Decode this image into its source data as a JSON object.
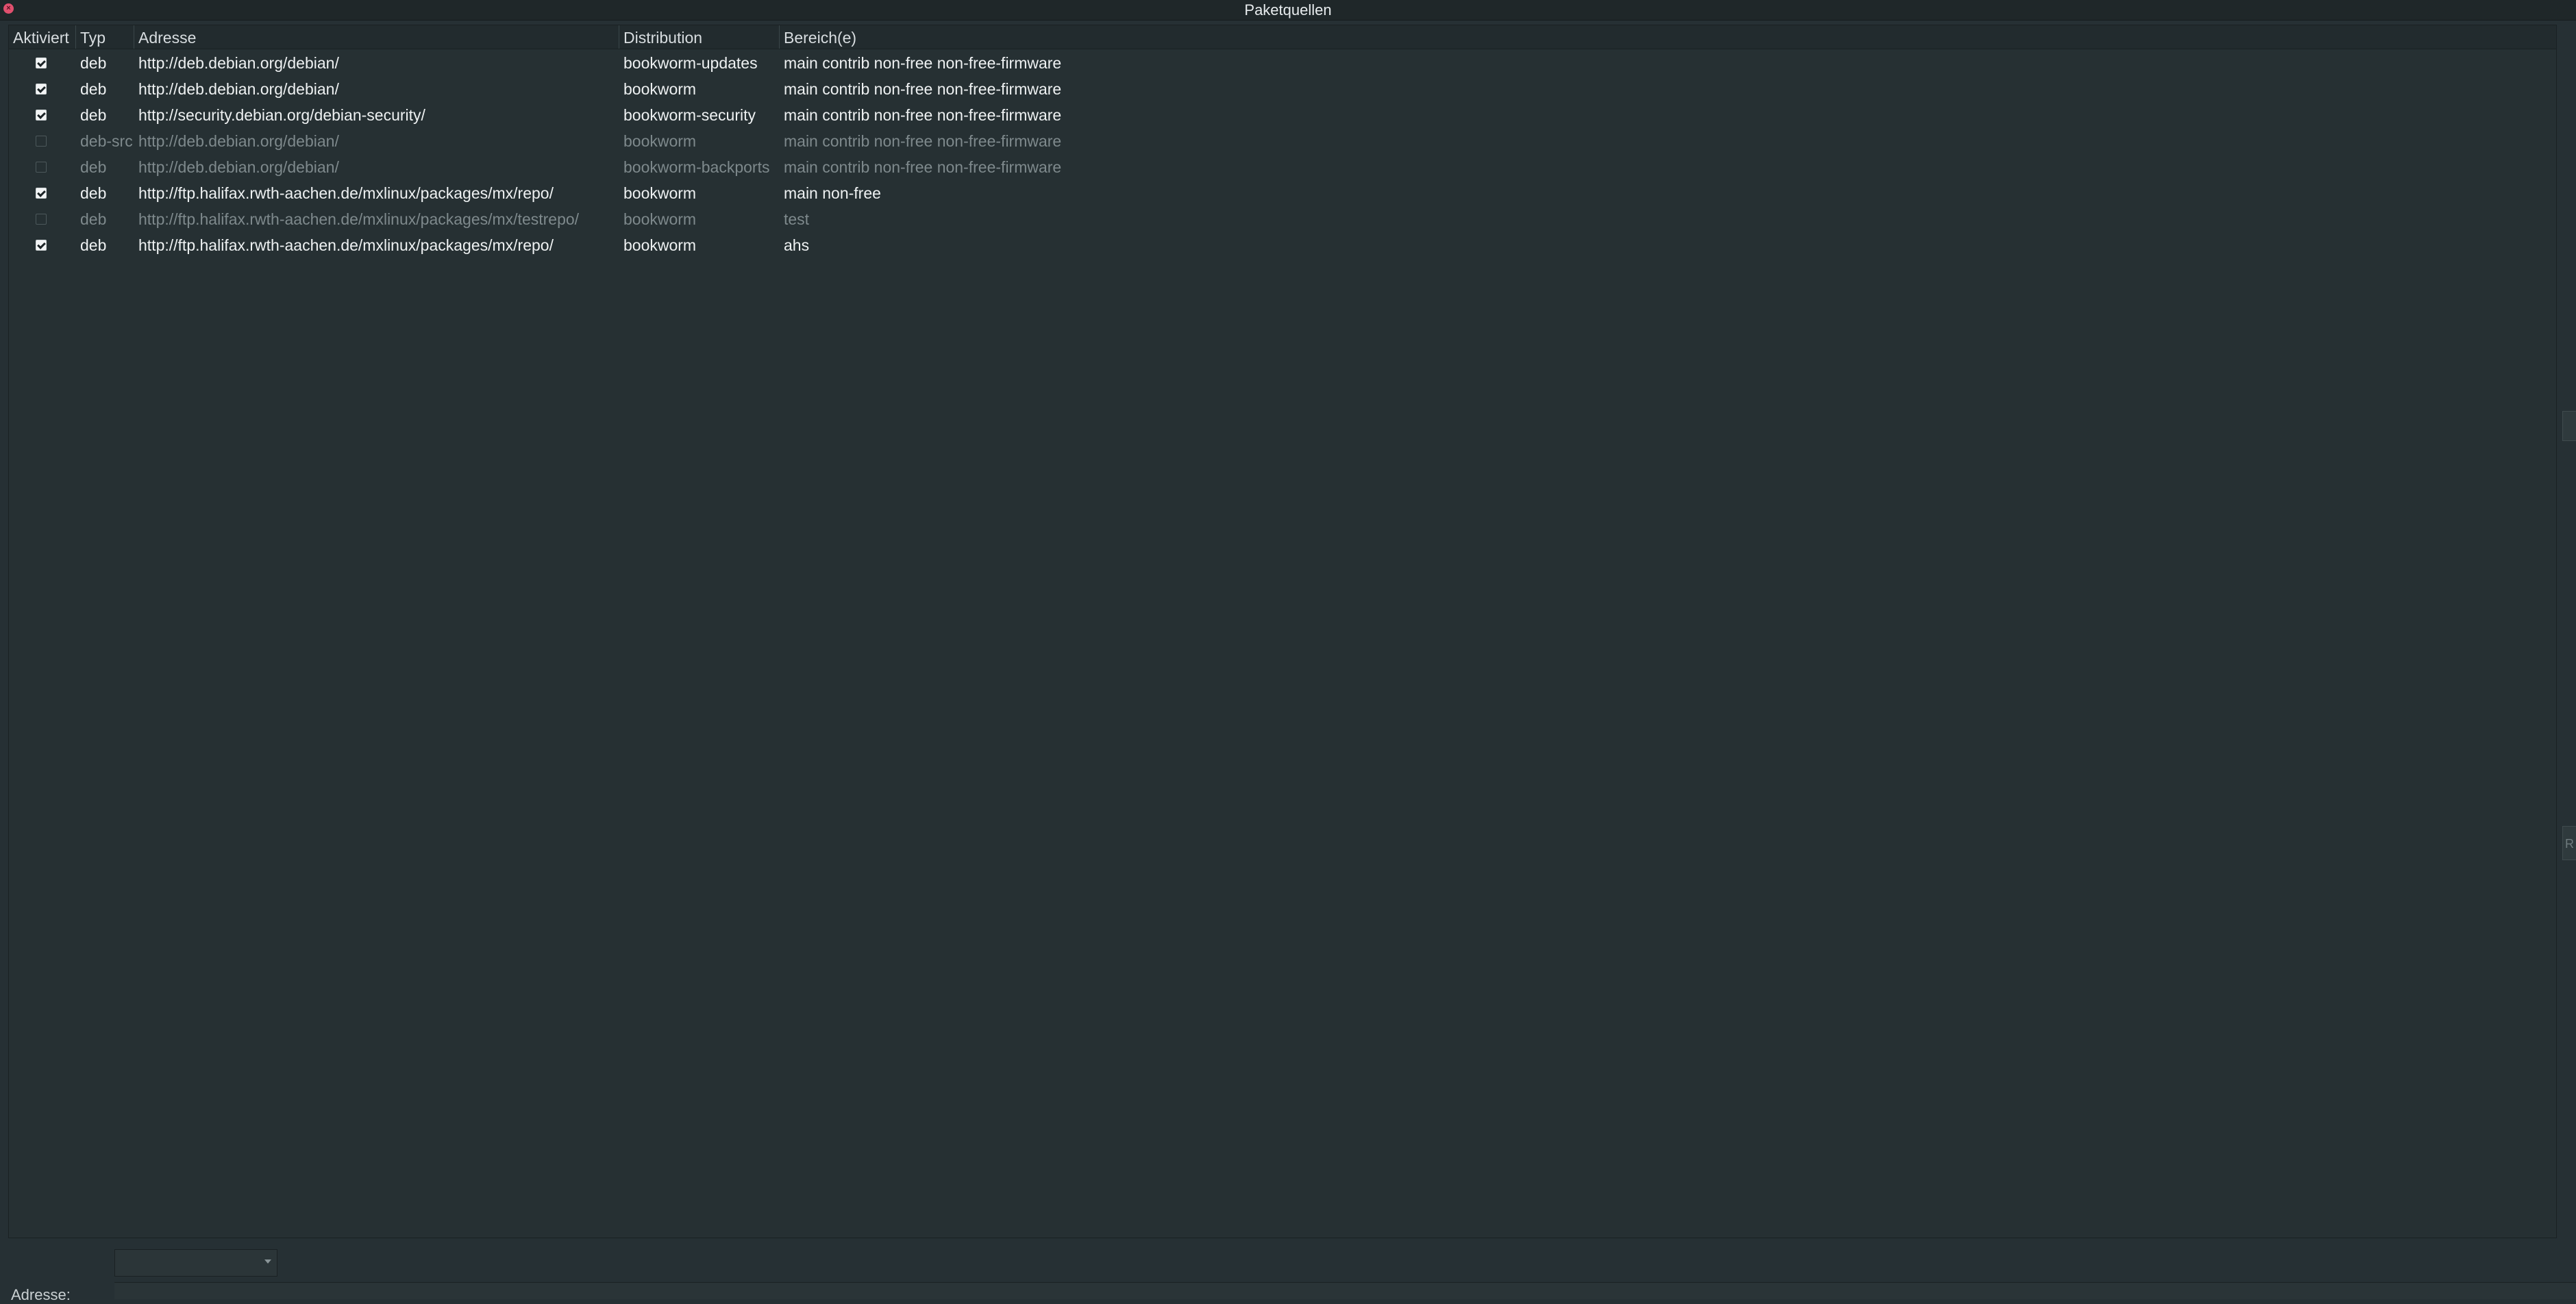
{
  "window": {
    "title": "Paketquellen"
  },
  "table": {
    "columns": [
      {
        "key": "enabled",
        "label": "Aktiviert"
      },
      {
        "key": "type",
        "label": "Typ"
      },
      {
        "key": "address",
        "label": "Adresse"
      },
      {
        "key": "distribution",
        "label": "Distribution"
      },
      {
        "key": "components",
        "label": "Bereich(e)"
      }
    ],
    "rows": [
      {
        "enabled": true,
        "type": "deb",
        "address": "http://deb.debian.org/debian/",
        "distribution": "bookworm-updates",
        "components": "main contrib non-free non-free-firmware"
      },
      {
        "enabled": true,
        "type": "deb",
        "address": "http://deb.debian.org/debian/",
        "distribution": "bookworm",
        "components": "main contrib non-free non-free-firmware"
      },
      {
        "enabled": true,
        "type": "deb",
        "address": "http://security.debian.org/debian-security/",
        "distribution": "bookworm-security",
        "components": "main contrib non-free non-free-firmware"
      },
      {
        "enabled": false,
        "type": "deb-src",
        "address": "http://deb.debian.org/debian/",
        "distribution": "bookworm",
        "components": "main contrib non-free non-free-firmware"
      },
      {
        "enabled": false,
        "type": "deb",
        "address": "http://deb.debian.org/debian/",
        "distribution": "bookworm-backports",
        "components": "main contrib non-free non-free-firmware"
      },
      {
        "enabled": true,
        "type": "deb",
        "address": "http://ftp.halifax.rwth-aachen.de/mxlinux/packages/mx/repo/",
        "distribution": "bookworm",
        "components": "main non-free"
      },
      {
        "enabled": false,
        "type": "deb",
        "address": "http://ftp.halifax.rwth-aachen.de/mxlinux/packages/mx/testrepo/",
        "distribution": "bookworm",
        "components": "test"
      },
      {
        "enabled": true,
        "type": "deb",
        "address": "http://ftp.halifax.rwth-aachen.de/mxlinux/packages/mx/repo/",
        "distribution": "bookworm",
        "components": "ahs"
      }
    ]
  },
  "form": {
    "address_label": "Adresse:",
    "type_combo_value": ""
  },
  "side_handle": {
    "lower_glyph": "R"
  },
  "icons": {
    "close": "close-icon",
    "combo_arrow": "chevron-down-icon"
  },
  "colors": {
    "close_button": "#e0506e",
    "background": "#263034"
  }
}
